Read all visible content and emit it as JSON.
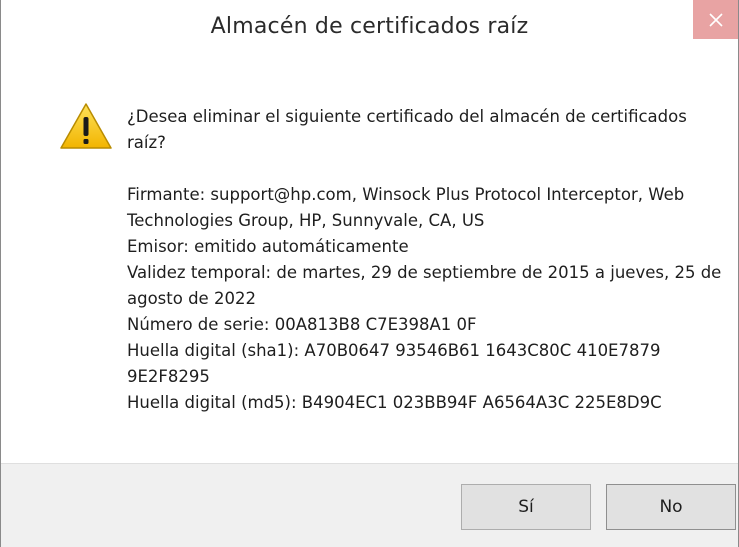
{
  "window": {
    "title": "Almacén de certificados raíz",
    "close_icon": "close-icon"
  },
  "icon": "warning-icon",
  "message": {
    "question": "¿Desea eliminar el siguiente certificado del almacén de certificados raíz?",
    "lines": [
      "Firmante: support@hp.com, Winsock Plus Protocol Interceptor, Web Technologies Group, HP, Sunnyvale, CA, US",
      "Emisor: emitido automáticamente",
      "Validez temporal: de martes, 29 de septiembre de 2015 a jueves, 25 de agosto de 2022",
      "Número de serie: 00A813B8 C7E398A1 0F",
      "Huella digital (sha1): A70B0647 93546B61 1643C80C 410E7879 9E2F8295",
      "Huella digital (md5): B4904EC1 023BB94F A6564A3C 225E8D9C"
    ]
  },
  "buttons": {
    "yes_label": "Sí",
    "no_label": "No"
  },
  "colors": {
    "close_bg": "#e8a3a3",
    "footer_bg": "#f0f0f0",
    "warning_yellow": "#f6c500"
  }
}
